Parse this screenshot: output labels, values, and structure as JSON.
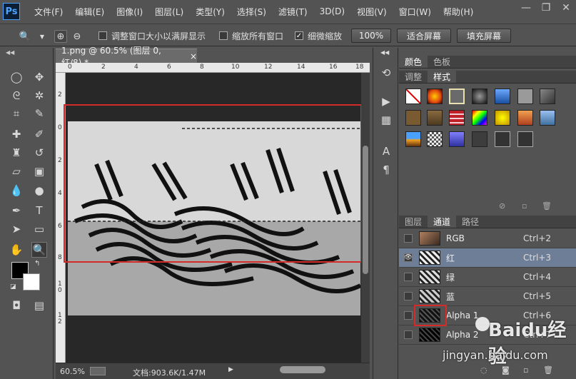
{
  "app": {
    "logo": "Ps"
  },
  "menu": [
    "文件(F)",
    "编辑(E)",
    "图像(I)",
    "图层(L)",
    "类型(Y)",
    "选择(S)",
    "滤镜(T)",
    "3D(D)",
    "视图(V)",
    "窗口(W)",
    "帮助(H)"
  ],
  "window_controls": {
    "minimize": "—",
    "restore": "❐",
    "close": "✕"
  },
  "options": {
    "resize_windows_label": "调整窗口大小以满屏显示",
    "zoom_all_label": "缩放所有窗口",
    "scrubby_zoom_label": "细微缩放",
    "scrubby_zoom_checked": true,
    "zoom_100_label": "100%",
    "fit_screen_label": "适合屏幕",
    "fill_screen_label": "填充屏幕"
  },
  "document": {
    "tab_title": "1.png @ 60.5% (图层 0, 红/8) *",
    "close_glyph": "×",
    "zoom": "60.5%",
    "doc_size": "文档:903.6K/1.47M",
    "ruler_top_labels": [
      "0",
      "2",
      "4",
      "6",
      "8",
      "10",
      "12",
      "14",
      "16",
      "18"
    ],
    "ruler_left_labels": [
      "2",
      "0",
      "2",
      "4",
      "6",
      "8",
      "1 0",
      "1 2"
    ]
  },
  "panels": {
    "color_tabs": [
      "颜色",
      "色板"
    ],
    "style_tabs": [
      "调整",
      "样式"
    ],
    "channel_tabs": [
      "图层",
      "通道",
      "路径"
    ],
    "styles": [
      {
        "icon": "none-style-icon",
        "color": "#ffffff"
      },
      {
        "icon": "orange-glow-icon",
        "color": "#e04a10"
      },
      {
        "icon": "frame-style-icon",
        "color": "#6a6a6a"
      },
      {
        "icon": "camera-style-icon",
        "color": "#2a2a2a"
      },
      {
        "icon": "blue-glass-icon",
        "color": "#2c6fd0"
      },
      {
        "icon": "gray-style-icon",
        "color": "#9a9a9a"
      },
      {
        "icon": "dark-gray-style-icon",
        "color": "#5a5a5a"
      },
      {
        "icon": "brown-style-icon",
        "color": "#7a5a30"
      },
      {
        "icon": "bronze-style-icon",
        "color": "#6d5533"
      },
      {
        "icon": "red-stripe-icon",
        "color": "#c0202a"
      },
      {
        "icon": "rainbow-style-icon",
        "color": "#7a3ad0"
      },
      {
        "icon": "yellow-style-icon",
        "color": "#e0c000"
      },
      {
        "icon": "sunset-style-icon",
        "color": "#d07030"
      },
      {
        "icon": "sky-style-icon",
        "color": "#6090c0"
      },
      {
        "icon": "horizon-style-icon",
        "color": "#e08a20"
      },
      {
        "icon": "pattern-style-icon",
        "color": "#cccccc"
      },
      {
        "icon": "purple-style-icon",
        "color": "#5050c0"
      },
      {
        "icon": "dark-style-icon",
        "color": "#3d3d3d"
      },
      {
        "icon": "black-outline-icon",
        "color": "#333333"
      },
      {
        "icon": "black-outline-icon",
        "color": "#333333"
      }
    ],
    "channels": [
      {
        "name": "RGB",
        "shortcut": "Ctrl+2",
        "visible": false,
        "selected": false,
        "thumb": "#8a6a50"
      },
      {
        "name": "红",
        "shortcut": "Ctrl+3",
        "visible": true,
        "selected": true,
        "thumb": "#9a9a9a"
      },
      {
        "name": "绿",
        "shortcut": "Ctrl+4",
        "visible": false,
        "selected": false,
        "thumb": "#8e8e8e"
      },
      {
        "name": "蓝",
        "shortcut": "Ctrl+5",
        "visible": false,
        "selected": false,
        "thumb": "#868686"
      },
      {
        "name": "Alpha 1",
        "shortcut": "Ctrl+6",
        "visible": false,
        "selected": false,
        "thumb": "#202020"
      },
      {
        "name": "Alpha 2",
        "shortcut": "Ctrl+7",
        "visible": false,
        "selected": false,
        "thumb": "#1a1a1a"
      }
    ]
  },
  "watermark": {
    "line1": "Baidu经验",
    "line2": "jingyan.baidu.com"
  },
  "colors": {
    "highlight_red": "#d42a2a",
    "selected_row": "#6f7e97"
  }
}
